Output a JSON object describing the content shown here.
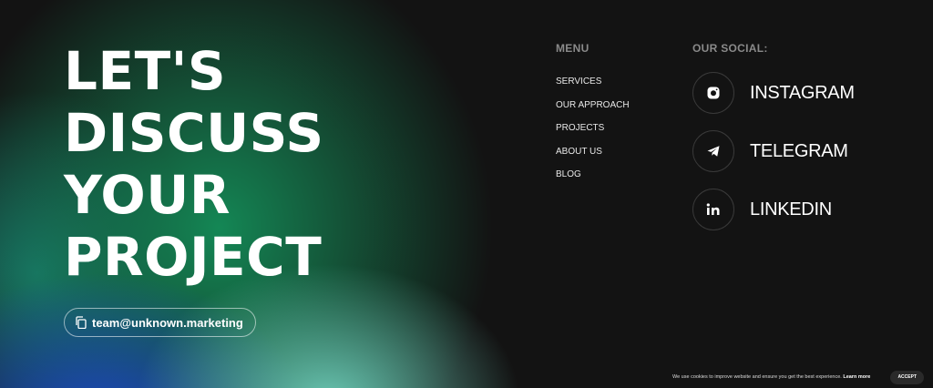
{
  "hero": {
    "headline_lines": [
      "LET'S",
      "DISCUSS",
      "YOUR",
      "PROJECT"
    ],
    "email": "team@unknown.marketing",
    "email_icon": "copy-icon"
  },
  "menu": {
    "title": "MENU",
    "items": [
      "SERVICES",
      "OUR APPROACH",
      "PROJECTS",
      "ABOUT US",
      "BLOG"
    ]
  },
  "social": {
    "title": "OUR SOCIAL:",
    "items": [
      {
        "label": "INSTAGRAM",
        "icon": "instagram-icon"
      },
      {
        "label": "TELEGRAM",
        "icon": "telegram-icon"
      },
      {
        "label": "LINKEDIN",
        "icon": "linkedin-icon"
      }
    ]
  },
  "cookie_banner": {
    "text": "We use cookies to improve website and ensure you get the best experience.",
    "learn_more": "Learn more",
    "accept": "ACCEPT"
  },
  "colors": {
    "background": "#131313",
    "green_glow": "#148755",
    "blue_glow": "#1c48c8",
    "teal_glow": "#6ecdb9",
    "muted_text": "#8a8a8a"
  }
}
